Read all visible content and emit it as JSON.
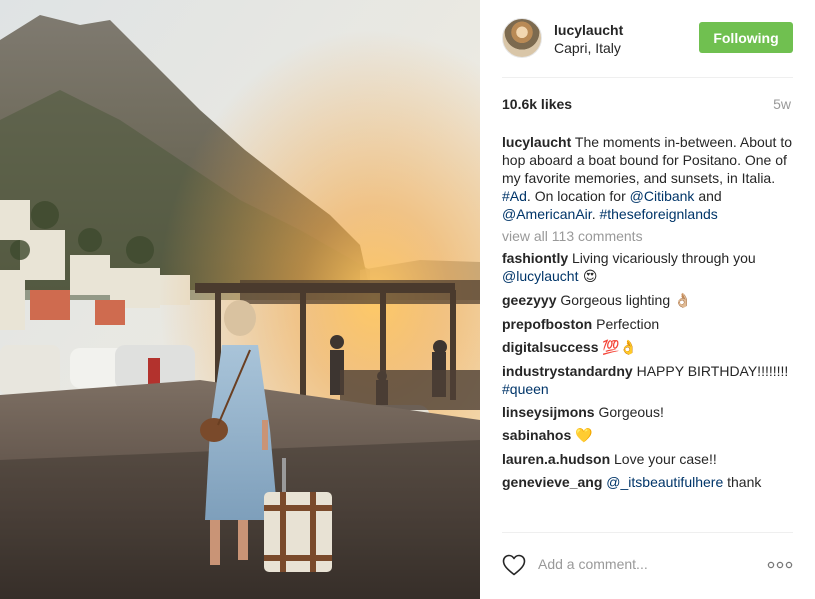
{
  "post": {
    "image_alt": "Woman with vintage suitcase walking toward harbour at sunset in Capri",
    "author": {
      "username": "lucylaucht",
      "location": "Capri, Italy",
      "follow_label": "Following"
    },
    "likes": "10.6k likes",
    "time_ago": "5w",
    "caption": {
      "username": "lucylaucht",
      "text_1": " The moments in-between. About to hop aboard a boat bound for Positano. One of my favorite memories, and sunsets, in Italia. ",
      "tag_ad": "#Ad",
      "text_2": ". On location for ",
      "mention_1": "@Citibank",
      "text_3": " and ",
      "mention_2": "@AmericanAir",
      "text_4": ". ",
      "hashtag": "#theseforeignlands"
    },
    "view_all_label": "view all 113 comments",
    "comments": [
      {
        "username": "fashiontly",
        "text": " Living vicariously through you ",
        "mention": "@lucylaucht",
        "emoji": " 😍"
      },
      {
        "username": "geezyyy",
        "text": " Gorgeous lighting ",
        "emoji": "👌🏼"
      },
      {
        "username": "prepofboston",
        "text": " Perfection"
      },
      {
        "username": "digitalsuccess",
        "text": " ",
        "emoji": "💯👌"
      },
      {
        "username": "industrystandardny",
        "text": " HAPPY BIRTHDAY!!!!!!!! ",
        "mention": "#queen"
      },
      {
        "username": "linseysijmons",
        "text": " Gorgeous!"
      },
      {
        "username": "sabinahos",
        "text": " ",
        "emoji": "💛"
      },
      {
        "username": "lauren.a.hudson",
        "text": " Love your case!!"
      },
      {
        "username": "genevieve_ang",
        "text": " ",
        "mention": "@_itsbeautifulhere",
        "text_after": " thank"
      }
    ],
    "add_comment_placeholder": "Add a comment...",
    "icons": {
      "like": "heart-icon",
      "more": "more-options-icon"
    },
    "colors": {
      "follow_button": "#70c050",
      "link": "#003569",
      "muted": "#999999"
    }
  }
}
